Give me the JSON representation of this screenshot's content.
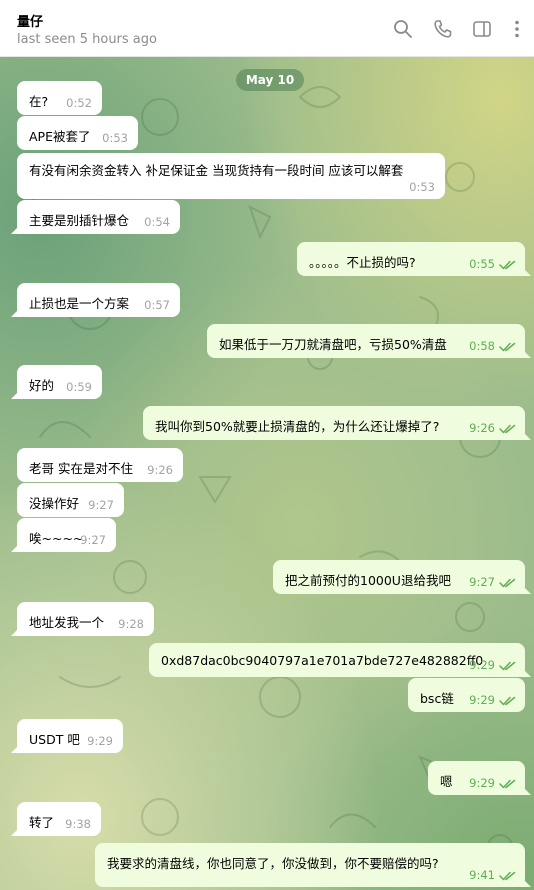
{
  "header": {
    "contact_name": "量仔",
    "status": "last seen 5 hours ago",
    "icons": [
      "search-icon",
      "phone-icon",
      "sidebar-icon",
      "more-icon"
    ]
  },
  "chat": {
    "date": "May 10",
    "messages": [
      {
        "dir": "in",
        "text": "在?",
        "time": "0:52"
      },
      {
        "dir": "in",
        "text": "APE被套了",
        "time": "0:53"
      },
      {
        "dir": "in",
        "text": "有没有闲余资金转入 补足保证金 当现货持有一段时间 应该可以解套",
        "time": "0:53"
      },
      {
        "dir": "in",
        "text": "主要是别插针爆仓",
        "time": "0:54"
      },
      {
        "dir": "out",
        "text": "。。。。。不止损的吗?",
        "time": "0:55"
      },
      {
        "dir": "in",
        "text": "止损也是一个方案",
        "time": "0:57"
      },
      {
        "dir": "out",
        "text": "如果低于一万刀就清盘吧，亏损50%清盘",
        "time": "0:58"
      },
      {
        "dir": "in",
        "text": "好的",
        "time": "0:59"
      },
      {
        "dir": "out",
        "text": "我叫你到50%就要止损清盘的，为什么还让爆掉了?",
        "time": "9:26"
      },
      {
        "dir": "in",
        "text": "老哥 实在是对不住",
        "time": "9:26"
      },
      {
        "dir": "in",
        "text": "没操作好",
        "time": "9:27"
      },
      {
        "dir": "in",
        "text": "唉~~~~",
        "time": "9:27"
      },
      {
        "dir": "out",
        "text": "把之前预付的1000U退给我吧",
        "time": "9:27"
      },
      {
        "dir": "in",
        "text": "地址发我一个",
        "time": "9:28"
      },
      {
        "dir": "out",
        "text": "0xd87dac0bc9040797a1e701a7bde727e482882ff0",
        "time": "9:29"
      },
      {
        "dir": "out",
        "text": "bsc链",
        "time": "9:29"
      },
      {
        "dir": "in",
        "text": "USDT 吧",
        "time": "9:29"
      },
      {
        "dir": "out",
        "text": "嗯",
        "time": "9:29"
      },
      {
        "dir": "in",
        "text": "转了",
        "time": "9:38"
      },
      {
        "dir": "out",
        "text": "我要求的清盘线，你也同意了，你没做到，你不要赔偿的吗?",
        "time": "9:41"
      }
    ]
  },
  "colors": {
    "incoming_bubble": "#ffffff",
    "outgoing_bubble": "#effdde",
    "read_check": "#5fae53",
    "date_pill": "#4e8056"
  }
}
